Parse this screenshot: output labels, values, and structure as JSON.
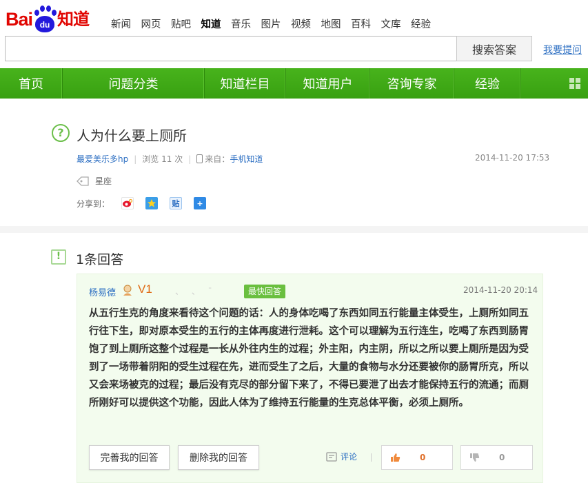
{
  "header": {
    "logo": {
      "bai": "Bai",
      "du": "du",
      "zhidao": "知道"
    },
    "nav": [
      "新闻",
      "网页",
      "贴吧",
      "知道",
      "音乐",
      "图片",
      "视频",
      "地图",
      "百科",
      "文库",
      "经验"
    ],
    "active_nav_index": 3
  },
  "search": {
    "value": "",
    "button_label": "搜索答案",
    "ask_link": "我要提问"
  },
  "main_nav": {
    "items": [
      "首页",
      "问题分类",
      "知道栏目",
      "知道用户",
      "咨询专家",
      "经验"
    ],
    "background": "#3ea716"
  },
  "question": {
    "icon": "question-circle-icon",
    "title": "人为什么要上厕所",
    "author": "最爱美乐多hp",
    "views_label": "浏览",
    "views": "11",
    "views_unit": "次",
    "from_label": "来自：",
    "from_value": "手机知道",
    "date": "2014-11-20 17:53",
    "tag": "星座",
    "share_label": "分享到："
  },
  "answers": {
    "count_label": "1条回答",
    "items": [
      {
        "user": "杨易德",
        "level": "V1",
        "blurred": "、 、 ˉ",
        "badge": "最快回答",
        "date": "2014-11-20 20:14",
        "text": "从五行生克的角度来看待这个问题的话：人的身体吃喝了东西如同五行能量主体受生，上厕所如同五行往下生，即对原本受生的五行的主体再度进行泄耗。这个可以理解为五行连生，吃喝了东西到肠胃饱了到上厕所这整个过程是一长从外往内生的过程；外主阳，内主阴，所以之所以要上厕所是因为受到了一场带着阴阳的受生过程在先，进而受生了之后，大量的食物与水分还要被你的肠胃所克，所以又会来场被克的过程；最后没有克尽的部分留下来了，不得已要泄了出去才能保持五行的流通；而厕所刚好可以提供这个功能，因此人体为了维持五行能量的生克总体平衡，必须上厕所。",
        "edit_button": "完善我的回答",
        "delete_button": "删除我的回答",
        "comment_label": "评论",
        "upvotes": "0",
        "downvotes": "0"
      }
    ]
  },
  "colors": {
    "brand_red": "#e10602",
    "brand_blue": "#2319dc",
    "green": "#3ea716",
    "link": "#2b6ec2",
    "answer_bg": "#f3fcee"
  }
}
